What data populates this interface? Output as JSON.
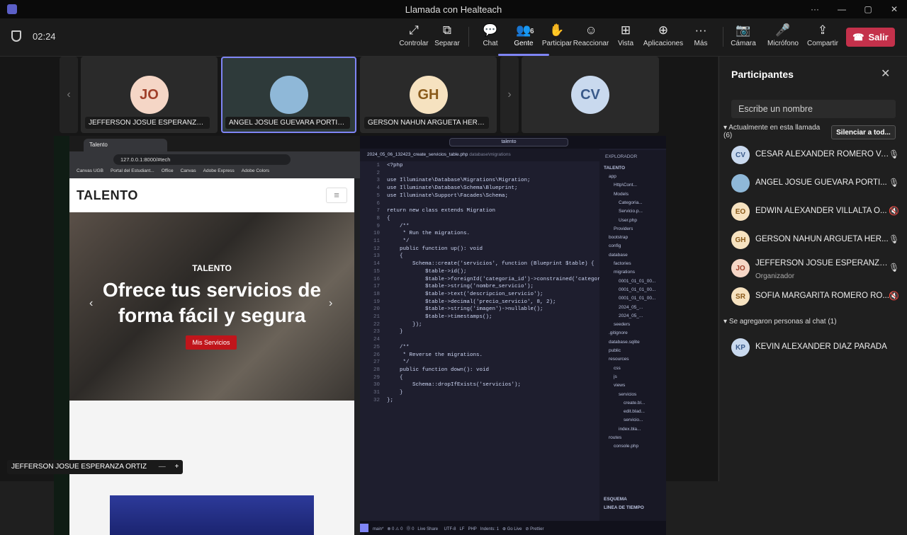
{
  "window": {
    "title": "Llamada con Healteach",
    "min": "—",
    "max": "▢",
    "close": "✕",
    "more": "···"
  },
  "call": {
    "timer": "02:24"
  },
  "toolbar": [
    {
      "key": "controlar",
      "label": "Controlar",
      "icon": "⤢"
    },
    {
      "key": "separar",
      "label": "Separar",
      "icon": "⧉"
    },
    {
      "key": "chat",
      "label": "Chat",
      "icon": "💬"
    },
    {
      "key": "gente",
      "label": "Gente",
      "icon": "👥",
      "badge": "6"
    },
    {
      "key": "participar",
      "label": "Participar",
      "icon": "✋"
    },
    {
      "key": "reaccionar",
      "label": "Reaccionar",
      "icon": "☺"
    },
    {
      "key": "vista",
      "label": "Vista",
      "icon": "⊞"
    },
    {
      "key": "aplicaciones",
      "label": "Aplicaciones",
      "icon": "⊕"
    },
    {
      "key": "mas",
      "label": "Más",
      "icon": "···"
    },
    {
      "key": "camara",
      "label": "Cámara",
      "icon": "📷"
    },
    {
      "key": "microfono",
      "label": "Micrófono",
      "icon": "🎤"
    },
    {
      "key": "compartir",
      "label": "Compartir",
      "icon": "⇪"
    }
  ],
  "leave": {
    "label": "Salir"
  },
  "tiles": [
    {
      "initials": "JO",
      "name": "JEFFERSON JOSUE ESPERANZA OR...",
      "bg": "#f5d6c6",
      "fg": "#a0402a"
    },
    {
      "initials": "",
      "name": "ANGEL JOSUE GUEVARA PORTILLO",
      "bg": "#8fb8d8",
      "fg": "#fff"
    },
    {
      "initials": "GH",
      "name": "GERSON NAHUN ARGUETA HERNA...",
      "bg": "#f6e2c0",
      "fg": "#8a5a1a"
    },
    {
      "initials": "CV",
      "name": "",
      "bg": "#c9d9ee",
      "fg": "#3a5a8a"
    }
  ],
  "browser": {
    "tab": "Talento",
    "url": "127.0.0.1:8000/#tech",
    "bookmarks": [
      "Canvas UGB",
      "Portal del Estudiant...",
      "Office",
      "Canvas",
      "Adobe Express",
      "Adobe Colors"
    ],
    "brand": "TALENTO",
    "hero_small": "TALENTO",
    "hero_title": "Ofrece tus servicios de forma fácil y segura",
    "hero_button": "Mis Servicios"
  },
  "vscode": {
    "search": "talento",
    "file_tab": "2024_05_06_132423_create_servicios_table.php",
    "file_path": "database\\migrations",
    "explorer_title": "EXPLORADOR",
    "project": "TALENTO",
    "statusbar": "main*   ⊗ 0 ⚠ 0   ⓪ 0   Live Share     UTF-8   LF   PHP   Indents: 1   ⊕ Go Live   ⊘ Prettier",
    "code": [
      "<?php",
      "",
      "use Illuminate\\Database\\Migrations\\Migration;",
      "use Illuminate\\Database\\Schema\\Blueprint;",
      "use Illuminate\\Support\\Facades\\Schema;",
      "",
      "return new class extends Migration",
      "{",
      "    /**",
      "     * Run the migrations.",
      "     */",
      "    public function up(): void",
      "    {",
      "        Schema::create('servicios', function (Blueprint $table) {",
      "            $table->id();",
      "            $table->foreignId('categoria_id')->constrained('categoria",
      "            $table->string('nombre_servicio');",
      "            $table->text('descripcion_servicio');",
      "            $table->decimal('precio_servicio', 8, 2);",
      "            $table->string('imagen')->nullable();",
      "            $table->timestamps();",
      "        });",
      "    }",
      "",
      "    /**",
      "     * Reverse the migrations.",
      "     */",
      "    public function down(): void",
      "    {",
      "        Schema::dropIfExists('servicios');",
      "    }",
      "};"
    ],
    "tree": [
      "app",
      "Http\\Cont...",
      "Models",
      "Categoria...",
      "Servicio.p...",
      "User.php",
      "Providers",
      "bootstrap",
      "config",
      "database",
      "factories",
      "migrations",
      "0001_01_01_00...",
      "0001_01_01_00...",
      "0001_01_01_00...",
      "2024_05_...",
      "2024_05_...",
      "seeders",
      ".gitignore",
      "database.sqlite",
      "public",
      "resources",
      "css",
      "js",
      "views",
      "servicios",
      "create.bl...",
      "edit.blad...",
      "servicio...",
      "index.bla...",
      "routes",
      "console.php"
    ],
    "outline": "ESQUEMA",
    "timeline": "LÍNEA DE TIEMPO"
  },
  "presenter": {
    "name": "JEFFERSON JOSUE ESPERANZA ORTIZ"
  },
  "panel": {
    "title": "Participantes",
    "search_placeholder": "Escribe un nombre",
    "in_call": "Actualmente en esta llamada (6)",
    "mute_all": "Silenciar a tod...",
    "participants": [
      {
        "initials": "CV",
        "name": "CESAR ALEXANDER ROMERO VA...",
        "role": "",
        "mic": "🎙",
        "bg": "#c9d9ee",
        "fg": "#3a5a8a"
      },
      {
        "initials": "",
        "name": "ANGEL JOSUE GUEVARA PORTI...",
        "role": "",
        "mic": "🎙",
        "bg": "#8fb8d8",
        "fg": "#fff"
      },
      {
        "initials": "EO",
        "name": "EDWIN ALEXANDER VILLALTA O...",
        "role": "",
        "mic": "🔇",
        "bg": "#f6e2c0",
        "fg": "#8a5a1a"
      },
      {
        "initials": "GH",
        "name": "GERSON NAHUN ARGUETA HER...",
        "role": "",
        "mic": "🎙",
        "bg": "#f6e2c0",
        "fg": "#8a5a1a"
      },
      {
        "initials": "JO",
        "name": "JEFFERSON JOSUE ESPERANZA ...",
        "role": "Organizador",
        "mic": "🎙",
        "bg": "#f5d6c6",
        "fg": "#a0402a"
      },
      {
        "initials": "SR",
        "name": "SOFÍA MARGARITA ROMERO RO...",
        "role": "",
        "mic": "🔇",
        "bg": "#f6e2c0",
        "fg": "#8a5a1a"
      }
    ],
    "added": "Se agregaron personas al chat (1)",
    "added_people": [
      {
        "initials": "KP",
        "name": "KEVIN ALEXANDER DIAZ PARADA",
        "bg": "#c9d9ee",
        "fg": "#3a5a8a"
      }
    ]
  }
}
